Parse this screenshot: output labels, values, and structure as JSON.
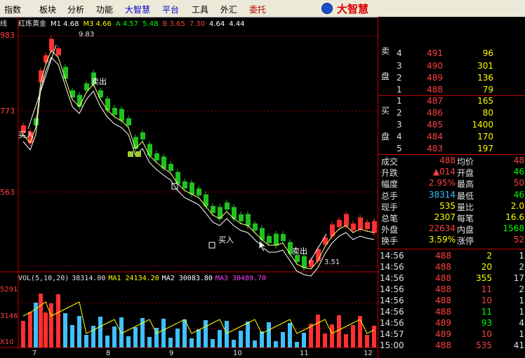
{
  "menu": [
    {
      "label": "指数",
      "color": "normal"
    },
    {
      "label": "板块",
      "color": "normal"
    },
    {
      "label": "分析",
      "color": "normal"
    },
    {
      "label": "功能",
      "color": "normal"
    },
    {
      "label": "大智慧",
      "color": "blue"
    },
    {
      "label": "平台",
      "color": "blue"
    },
    {
      "label": "工具",
      "color": "normal"
    },
    {
      "label": "外汇",
      "color": "normal"
    },
    {
      "label": "委托",
      "color": "red"
    }
  ],
  "logo_text": "大智慧",
  "cut_label": "线",
  "legend": {
    "name": "红练黄金",
    "items": [
      {
        "text": "M1 4.68",
        "color": "#ffffff"
      },
      {
        "text": "M3 4.66",
        "color": "#ffff00"
      },
      {
        "text": "A 4.57",
        "color": "#00ff00"
      },
      {
        "text": "5.48",
        "color": "#00ff00"
      },
      {
        "text": "B 3.65",
        "color": "#ff4040"
      },
      {
        "text": "7.30",
        "color": "#ff4040"
      },
      {
        "text": "4.64",
        "color": "#ffffff"
      },
      {
        "text": "4.44",
        "color": "#ffffff"
      }
    ]
  },
  "price_axis": [
    "983",
    "773",
    "563"
  ],
  "price_annotations": {
    "high": "9.83",
    "low": "3.51",
    "buy1": "买入",
    "buy2": "买入",
    "sell1": "卖出",
    "sell2": "卖出"
  },
  "vol_legend": [
    {
      "text": "VOL(5,10,20)",
      "color": "#e0e0e0"
    },
    {
      "text": "38314.00",
      "color": "#e0e0e0"
    },
    {
      "text": "MA1 24134.20",
      "color": "#ffff00"
    },
    {
      "text": "MA2 30083.80",
      "color": "#ffffff"
    },
    {
      "text": "MA3 30489.70",
      "color": "#ff40ff"
    }
  ],
  "vol_axis": [
    "5291",
    "3146",
    "X10"
  ],
  "x_axis": [
    "7",
    "8",
    "9",
    "10",
    "11",
    "12"
  ],
  "order_book": {
    "sell_label": [
      "卖",
      "盘"
    ],
    "buy_label": [
      "买",
      "盘"
    ],
    "asks": [
      {
        "level": "4",
        "price": "491",
        "vol": "96"
      },
      {
        "level": "3",
        "price": "490",
        "vol": "301"
      },
      {
        "level": "2",
        "price": "489",
        "vol": "136"
      },
      {
        "level": "1",
        "price": "488",
        "vol": "79"
      }
    ],
    "bids": [
      {
        "level": "1",
        "price": "487",
        "vol": "165"
      },
      {
        "level": "2",
        "price": "486",
        "vol": "80"
      },
      {
        "level": "3",
        "price": "485",
        "vol": "1400"
      },
      {
        "level": "4",
        "price": "484",
        "vol": "170"
      },
      {
        "level": "5",
        "price": "483",
        "vol": "197"
      }
    ]
  },
  "stats": [
    {
      "l1": "成交",
      "v1": "488",
      "l2": "均价",
      "v2": "48",
      "v1c": "#ff4040",
      "v2c": "#ff4040"
    },
    {
      "l1": "升跌",
      "v1": "▲014",
      "l2": "开盘",
      "v2": "46",
      "v1c": "#ff4040",
      "v2c": "#00ff00"
    },
    {
      "l1": "幅度",
      "v1": "2.95%",
      "l2": "最高",
      "v2": "50",
      "v1c": "#ff4040",
      "v2c": "#ff4040"
    },
    {
      "l1": "总手",
      "v1": "38314",
      "l2": "最低",
      "v2": "46",
      "v1c": "#40c0ff",
      "v2c": "#00ff00"
    },
    {
      "l1": "现手",
      "v1": "535",
      "l2": "量比",
      "v2": "2.0",
      "v1c": "#ffff00",
      "v2c": "#ffff00"
    },
    {
      "l1": "总笔",
      "v1": "2307",
      "l2": "每笔",
      "v2": "16.6",
      "v1c": "#ffff00",
      "v2c": "#ffff00"
    },
    {
      "l1": "外盘",
      "v1": "22634",
      "l2": "内盘",
      "v2": "1568",
      "v1c": "#ff4040",
      "v2c": "#00ff00"
    },
    {
      "l1": "换手",
      "v1": "3.59%",
      "l2": "涨停",
      "v2": "52",
      "v1c": "#ffff00",
      "v2c": "#ff4040"
    }
  ],
  "ticks": [
    {
      "time": "14:56",
      "price": "488",
      "vol": "2",
      "n": "1",
      "vc": "#ffff00"
    },
    {
      "time": "14:56",
      "price": "488",
      "vol": "20",
      "n": "2",
      "vc": "#ffff00"
    },
    {
      "time": "14:56",
      "price": "488",
      "vol": "355",
      "n": "17",
      "vc": "#ffff00"
    },
    {
      "time": "14:56",
      "price": "488",
      "vol": "11",
      "n": "2",
      "vc": "#ff4040"
    },
    {
      "time": "14:56",
      "price": "488",
      "vol": "10",
      "n": "1",
      "vc": "#ff4040"
    },
    {
      "time": "14:56",
      "price": "488",
      "vol": "11",
      "n": "1",
      "vc": "#00ff00"
    },
    {
      "time": "14:56",
      "price": "489",
      "vol": "93",
      "n": "4",
      "vc": "#00ff00"
    },
    {
      "time": "14:57",
      "price": "489",
      "vol": "10",
      "n": "1",
      "vc": "#ff4040"
    },
    {
      "time": "15:00",
      "price": "488",
      "vol": "535",
      "n": "41",
      "vc": "#ff4040"
    }
  ]
}
